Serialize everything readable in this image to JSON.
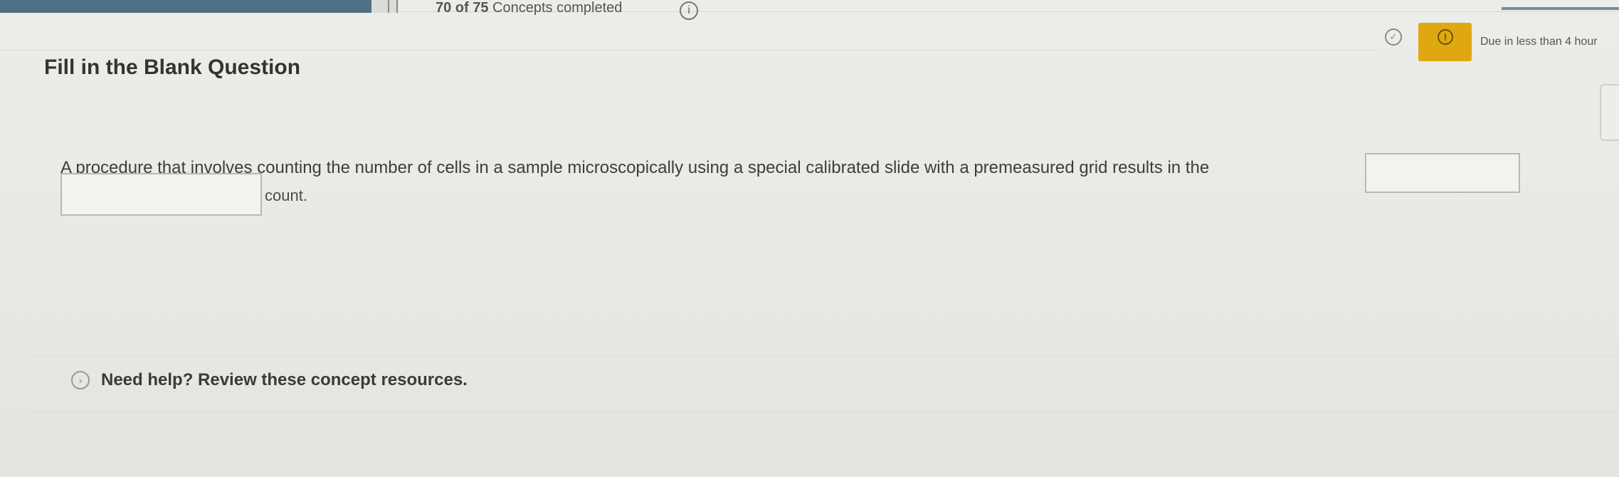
{
  "header": {
    "progress": {
      "completed": 70,
      "total": 75,
      "fraction": 0.933,
      "count_label": "70 of 75",
      "suffix_label": "Concepts completed"
    },
    "info_icon": "info-icon",
    "status": {
      "due_text": "Due in less than 4 hour",
      "badge_color": "#e0a810",
      "badge_icon": "alert-icon"
    }
  },
  "question": {
    "type_title": "Fill in the Blank Question",
    "text_before": "A procedure that involves counting the number of cells in a sample microscopically using a special calibrated slide with a premeasured grid results in the",
    "blank_1_value": "",
    "blank_2_value": "",
    "text_after": "count."
  },
  "help": {
    "label": "Need help? Review these concept resources."
  },
  "colors": {
    "progress_fill": "#4f6f86",
    "background": "#e9e9e5"
  }
}
